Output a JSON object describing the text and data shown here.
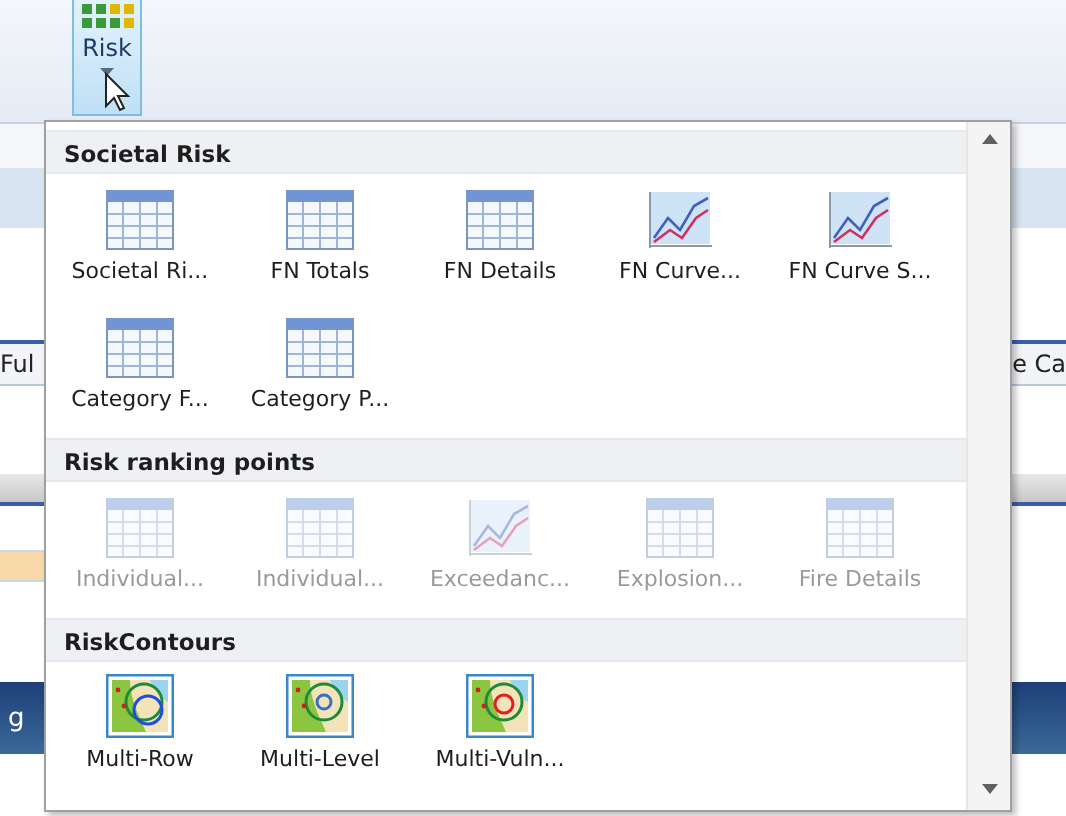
{
  "ribbon": {
    "risk_button": {
      "label": "Risk",
      "selected": true
    }
  },
  "background": {
    "tab_left": "Ful",
    "tab_right": "e Ca",
    "status_text": "g"
  },
  "dropdown": {
    "sections": [
      {
        "title": "Societal Risk",
        "items": [
          {
            "label": "Societal Ri...",
            "kind": "table",
            "disabled": false
          },
          {
            "label": "FN Totals",
            "kind": "table",
            "disabled": false
          },
          {
            "label": "FN Details",
            "kind": "table",
            "disabled": false
          },
          {
            "label": "FN Curve...",
            "kind": "chart",
            "disabled": false
          },
          {
            "label": "FN Curve S...",
            "kind": "chart",
            "disabled": false
          },
          {
            "label": "Category F...",
            "kind": "table",
            "disabled": false
          },
          {
            "label": "Category P...",
            "kind": "table",
            "disabled": false
          }
        ]
      },
      {
        "title": "Risk ranking points",
        "items": [
          {
            "label": "Individual...",
            "kind": "table",
            "disabled": true
          },
          {
            "label": "Individual...",
            "kind": "table",
            "disabled": true
          },
          {
            "label": "Exceedanc...",
            "kind": "chart",
            "disabled": true
          },
          {
            "label": "Explosion...",
            "kind": "table",
            "disabled": true
          },
          {
            "label": "Fire Details",
            "kind": "table",
            "disabled": true
          }
        ]
      },
      {
        "title": "RiskContours",
        "items": [
          {
            "label": "Multi-Row",
            "kind": "contour-large",
            "disabled": false
          },
          {
            "label": "Multi-Level",
            "kind": "contour-small",
            "disabled": false
          },
          {
            "label": "Multi-Vuln...",
            "kind": "contour-red",
            "disabled": false
          }
        ]
      }
    ]
  }
}
